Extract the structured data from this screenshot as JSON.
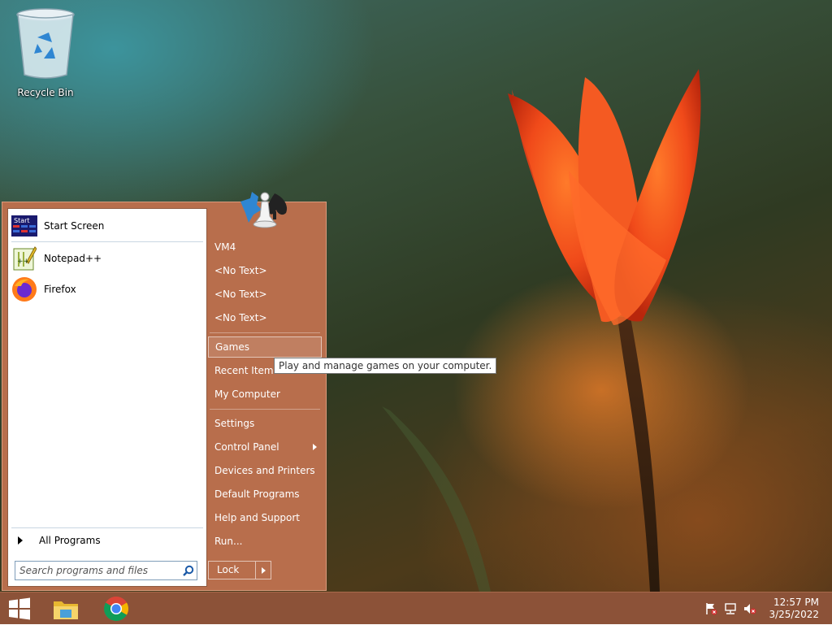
{
  "desktop": {
    "icons": [
      {
        "label": "Recycle Bin",
        "icon": "recycle-bin-icon"
      }
    ]
  },
  "start_menu": {
    "pinned_programs": [
      {
        "label": "Start Screen",
        "icon": "start-screen-icon"
      },
      {
        "label": "Notepad++",
        "icon": "notepad-plus-plus-icon"
      },
      {
        "label": "Firefox",
        "icon": "firefox-icon"
      }
    ],
    "all_programs_label": "All Programs",
    "search": {
      "placeholder": "Search programs and files",
      "icon": "search-icon"
    },
    "right_items": [
      {
        "label": "VM4"
      },
      {
        "label": "<No Text>"
      },
      {
        "label": "<No Text>"
      },
      {
        "label": "<No Text>"
      },
      {
        "label": "Games",
        "highlighted": true
      },
      {
        "label": "Recent Items"
      },
      {
        "label": "My Computer"
      },
      {
        "label": "Settings"
      },
      {
        "label": "Control Panel",
        "has_submenu": true
      },
      {
        "label": "Devices and Printers"
      },
      {
        "label": "Default Programs"
      },
      {
        "label": "Help and Support"
      },
      {
        "label": "Run..."
      }
    ],
    "lock_label": "Lock",
    "user_picture_icon": "games-chess-icon"
  },
  "tooltip": {
    "text": "Play and manage games on your computer."
  },
  "taskbar": {
    "buttons": [
      {
        "name": "start-button",
        "icon": "windows-logo-icon"
      },
      {
        "name": "file-explorer-button",
        "icon": "folder-icon"
      },
      {
        "name": "chrome-button",
        "icon": "chrome-icon"
      }
    ],
    "tray_icons": [
      "action-center-flag-icon",
      "network-icon",
      "volume-muted-icon"
    ],
    "clock": {
      "time": "12:57 PM",
      "date": "3/25/2022"
    }
  },
  "colors": {
    "start_menu_bg": "#b86e4c",
    "taskbar_bg": "#8c5238",
    "left_pane_bg": "#ffffff"
  }
}
